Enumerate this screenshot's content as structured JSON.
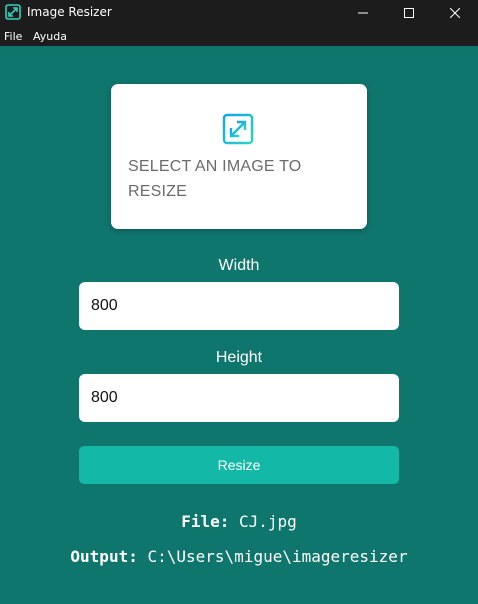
{
  "window": {
    "title": "Image Resizer",
    "icons": {
      "app": "resize-app-icon",
      "minimize": "minimize-icon",
      "maximize": "maximize-icon",
      "close": "close-icon"
    }
  },
  "menu": {
    "items": [
      {
        "label": "File"
      },
      {
        "label": "Ayuda"
      }
    ]
  },
  "dropzone": {
    "icon": "expand-arrows-icon",
    "text": "SELECT AN IMAGE TO RESIZE"
  },
  "form": {
    "width_label": "Width",
    "width_value": "800",
    "height_label": "Height",
    "height_value": "800",
    "resize_label": "Resize"
  },
  "info": {
    "file_key": "File:",
    "file_value": "CJ.jpg",
    "output_key": "Output:",
    "output_value": "C:\\Users\\migue\\imageresizer"
  },
  "colors": {
    "background": "#0f766e",
    "titlebar": "#1c1c1c",
    "accent": "#14b8a6",
    "card": "#ffffff"
  }
}
